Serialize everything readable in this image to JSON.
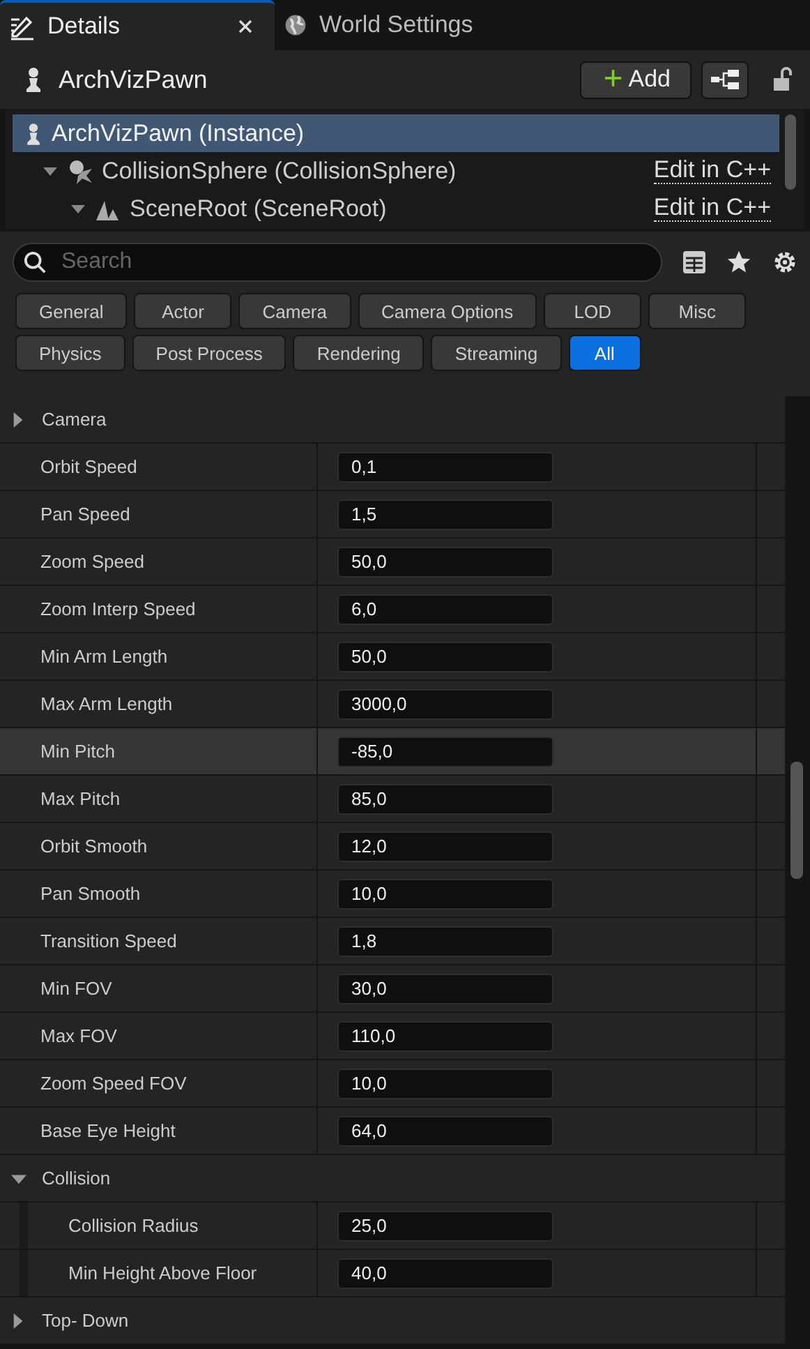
{
  "tabs": [
    {
      "label": "Details",
      "closable": true,
      "selected": true
    },
    {
      "label": "World Settings",
      "closable": false,
      "selected": false
    }
  ],
  "header": {
    "title": "ArchVizPawn",
    "add_button": "Add",
    "add_symbol": "+",
    "locked": false
  },
  "component_tree": [
    {
      "label": "ArchVizPawn (Instance)",
      "selected": true,
      "children": [
        {
          "label": "CollisionSphere (CollisionSphere)",
          "link": "Edit in C++",
          "expanded": true,
          "selected": false,
          "children": [
            {
              "label": "SceneRoot (SceneRoot)",
              "link": "Edit in C++",
              "expanded": true,
              "selected": false
            }
          ]
        }
      ]
    }
  ],
  "search": {
    "placeholder": "Search"
  },
  "filters": [
    [
      {
        "label": "General",
        "selected": false
      },
      {
        "label": "Actor",
        "selected": false
      },
      {
        "label": "Camera",
        "selected": false
      },
      {
        "label": "Camera Options",
        "selected": false
      },
      {
        "label": "LOD",
        "selected": false
      },
      {
        "label": "Misc",
        "selected": false
      }
    ],
    [
      {
        "label": "Physics",
        "selected": false
      },
      {
        "label": "Post Process",
        "selected": false
      },
      {
        "label": "Rendering",
        "selected": false
      },
      {
        "label": "Streaming",
        "selected": false
      },
      {
        "label": "All",
        "selected": true
      }
    ]
  ],
  "rows": [
    {
      "kind": "category",
      "label": "Camera",
      "expanded": false
    },
    {
      "kind": "property",
      "label": "Orbit Speed",
      "value": "0,1",
      "hovered": false
    },
    {
      "kind": "property",
      "label": "Pan Speed",
      "value": "1,5",
      "hovered": false
    },
    {
      "kind": "property",
      "label": "Zoom Speed",
      "value": "50,0",
      "hovered": false
    },
    {
      "kind": "property",
      "label": "Zoom Interp Speed",
      "value": "6,0",
      "hovered": false
    },
    {
      "kind": "property",
      "label": "Min Arm Length",
      "value": "50,0",
      "hovered": false
    },
    {
      "kind": "property",
      "label": "Max Arm Length",
      "value": "3000,0",
      "hovered": false
    },
    {
      "kind": "property",
      "label": "Min Pitch",
      "value": "-85,0",
      "hovered": true
    },
    {
      "kind": "property",
      "label": "Max Pitch",
      "value": "85,0",
      "hovered": false
    },
    {
      "kind": "property",
      "label": "Orbit Smooth",
      "value": "12,0",
      "hovered": false
    },
    {
      "kind": "property",
      "label": "Pan Smooth",
      "value": "10,0",
      "hovered": false
    },
    {
      "kind": "property",
      "label": "Transition Speed",
      "value": "1,8",
      "hovered": false
    },
    {
      "kind": "property",
      "label": "Min FOV",
      "value": "30,0",
      "hovered": false
    },
    {
      "kind": "property",
      "label": "Max FOV",
      "value": "110,0",
      "hovered": false
    },
    {
      "kind": "property",
      "label": "Zoom Speed FOV",
      "value": "10,0",
      "hovered": false
    },
    {
      "kind": "property",
      "label": "Base Eye Height",
      "value": "64,0",
      "hovered": false
    },
    {
      "kind": "category",
      "label": "Collision",
      "expanded": true,
      "children": [
        {
          "kind": "property",
          "label": "Collision Radius",
          "value": "25,0",
          "hovered": false
        },
        {
          "kind": "property",
          "label": "Min Height Above Floor",
          "value": "40,0",
          "hovered": false
        }
      ]
    },
    {
      "kind": "category",
      "label": "Top- Down",
      "expanded": false
    }
  ]
}
